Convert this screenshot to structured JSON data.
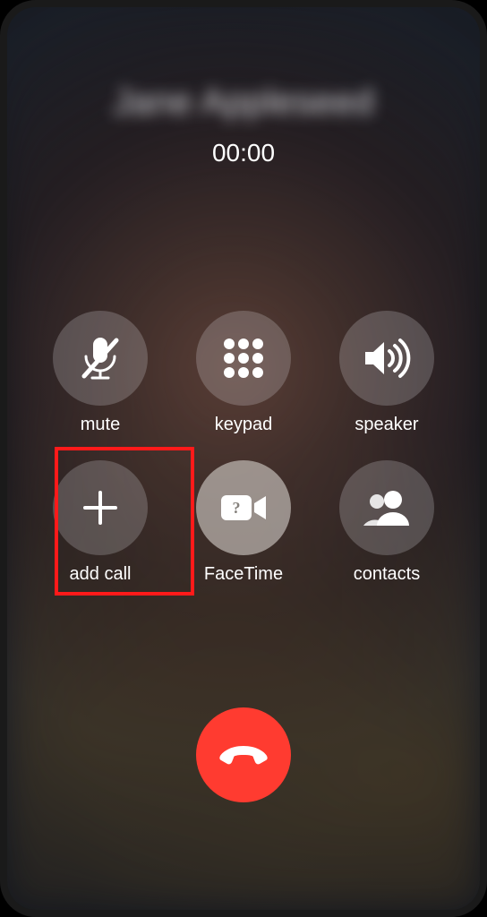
{
  "caller": {
    "name": "Jane Appleseed"
  },
  "call": {
    "duration": "00:00"
  },
  "buttons": {
    "mute": {
      "label": "mute"
    },
    "keypad": {
      "label": "keypad"
    },
    "speaker": {
      "label": "speaker"
    },
    "addcall": {
      "label": "add call"
    },
    "facetime": {
      "label": "FaceTime"
    },
    "contacts": {
      "label": "contacts"
    }
  },
  "colors": {
    "end_call": "#ff3b30",
    "highlight": "#ff1a1a",
    "icon": "#ffffff"
  }
}
